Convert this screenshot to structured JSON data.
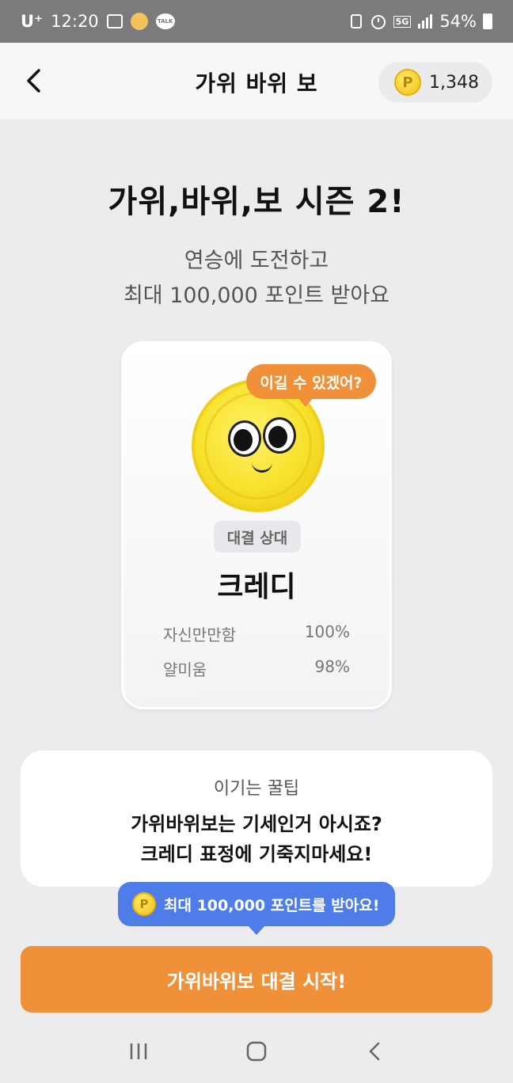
{
  "status_bar": {
    "carrier": "U⁺",
    "time": "12:20",
    "network": "5G",
    "battery": "54%"
  },
  "header": {
    "title": "가위 바위 보",
    "points": "1,348",
    "coin_letter": "P"
  },
  "main": {
    "title": "가위,바위,보 시즌 2!",
    "subtitle_line1": "연승에 도전하고",
    "subtitle_line2": "최대 100,000 포인트 받아요"
  },
  "opponent": {
    "speech": "이길 수 있겠어?",
    "badge": "대결 상대",
    "name": "크레디",
    "stats": [
      {
        "label": "자신만만함",
        "value": "100%"
      },
      {
        "label": "얄미움",
        "value": "98%"
      }
    ]
  },
  "tip": {
    "title": "이기는 꿀팁",
    "line1": "가위바위보는 기세인거 아시죠?",
    "line2": "크레디 표정에 기죽지마세요!"
  },
  "promo": {
    "text": "최대 100,000 포인트를 받아요!",
    "coin_letter": "P"
  },
  "start_button": {
    "label": "가위바위보 대결 시작!"
  },
  "colors": {
    "accent_orange": "#f0913a",
    "promo_blue": "#4e7de9",
    "coin_yellow": "#f7e12a"
  }
}
